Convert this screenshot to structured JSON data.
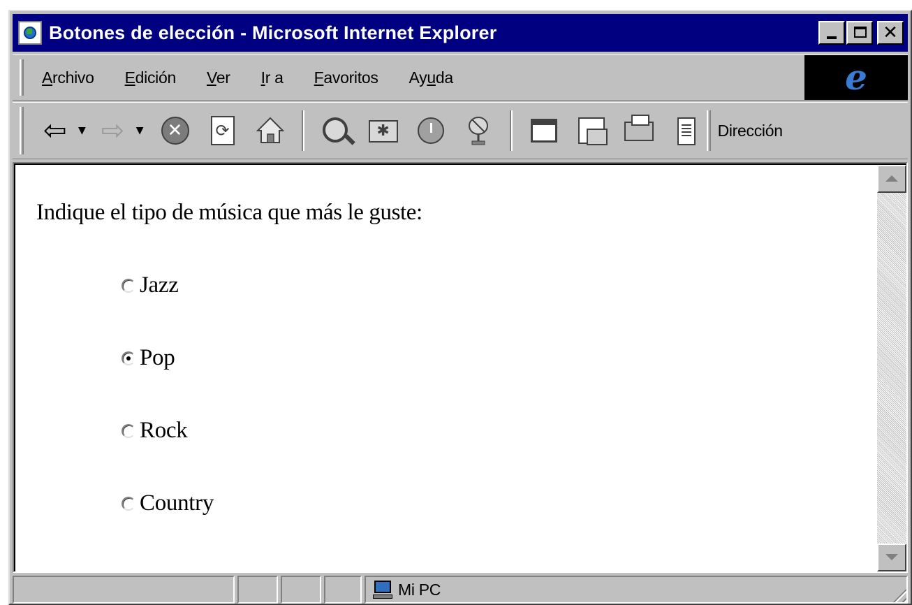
{
  "window": {
    "title": "Botones de elección - Microsoft Internet Explorer"
  },
  "menu": {
    "items": [
      {
        "accel": "A",
        "rest": "rchivo"
      },
      {
        "accel": "E",
        "rest": "dición"
      },
      {
        "accel": "V",
        "rest": "er"
      },
      {
        "accel": "I",
        "rest": "r a"
      },
      {
        "accel": "F",
        "rest": "avoritos"
      },
      {
        "pre": "Ay",
        "accel": "u",
        "rest": "da"
      }
    ]
  },
  "toolbar": {
    "icons": [
      "back-icon",
      "forward-icon",
      "stop-icon",
      "refresh-icon",
      "home-icon",
      "search-icon",
      "favorites-icon",
      "history-icon",
      "channels-icon",
      "fullscreen-icon",
      "mail-icon",
      "print-icon",
      "edit-icon"
    ],
    "address_label": "Dirección"
  },
  "page": {
    "prompt": "Indique el tipo de música que más le guste:",
    "options": [
      {
        "label": "Jazz",
        "checked": false
      },
      {
        "label": "Pop",
        "checked": true
      },
      {
        "label": "Rock",
        "checked": false
      },
      {
        "label": "Country",
        "checked": false
      }
    ]
  },
  "status": {
    "zone_label": "Mi PC"
  }
}
